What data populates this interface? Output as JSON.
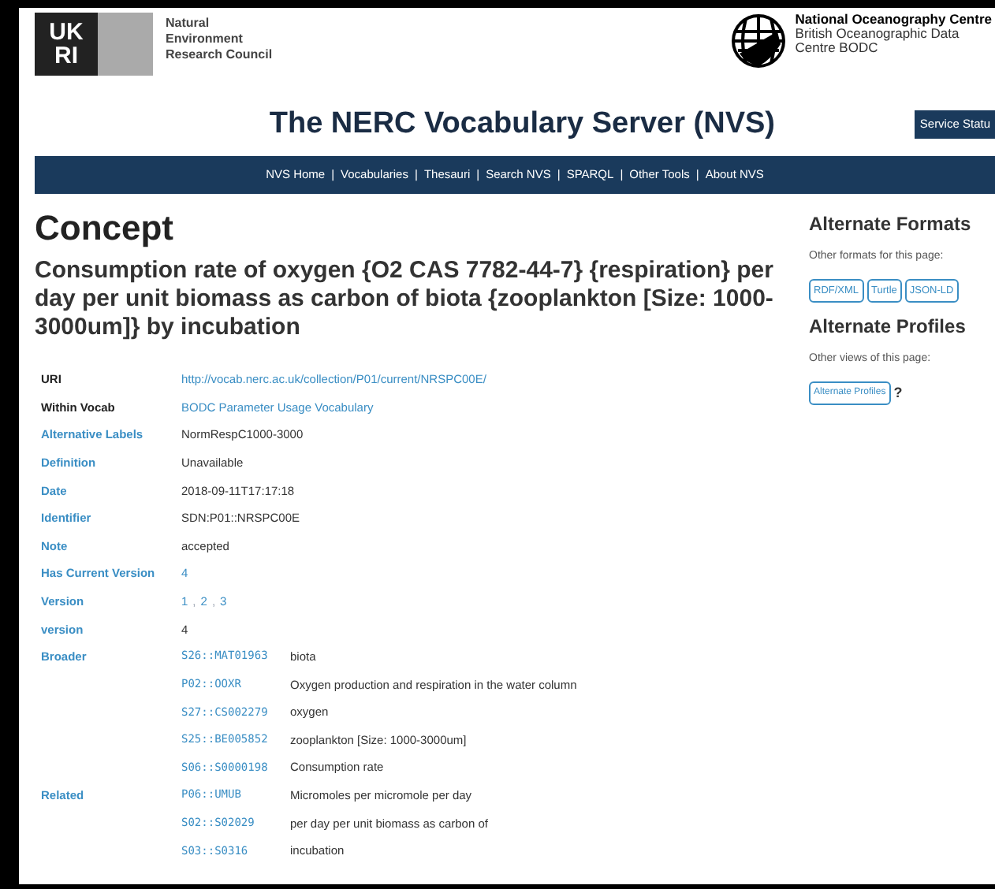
{
  "header": {
    "ukri_logo": [
      "UK",
      "RI"
    ],
    "nerc_name": [
      "Natural",
      "Environment",
      "Research Council"
    ],
    "noc_name": "National Oceanography Centre",
    "bodc_name": [
      "British Oceanographic Data",
      "Centre BODC"
    ]
  },
  "site_title": "The NERC Vocabulary Server (NVS)",
  "service_status": "Service Statu",
  "nav_separator": "|",
  "version_separator": ",",
  "nav": [
    "NVS Home",
    "Vocabularies",
    "Thesauri",
    "Search NVS",
    "SPARQL",
    "Other Tools",
    "About NVS"
  ],
  "heading": "Concept",
  "pref_label": "Consumption rate of oxygen {O2 CAS 7782-44-7} {respiration} per day per unit biomass as carbon of biota {zooplankton [Size: 1000-3000um]} by incubation",
  "properties": [
    {
      "label": "URI",
      "label_link": false,
      "kind": "link",
      "values": [
        "http://vocab.nerc.ac.uk/collection/P01/current/NRSPC00E/"
      ]
    },
    {
      "label": "Within Vocab",
      "label_link": false,
      "kind": "link",
      "values": [
        "BODC Parameter Usage Vocabulary"
      ]
    },
    {
      "label": "Alternative Labels",
      "label_link": true,
      "kind": "text",
      "values": [
        "NormRespC1000-3000"
      ]
    },
    {
      "label": "Definition",
      "label_link": true,
      "kind": "text",
      "values": [
        "Unavailable"
      ]
    },
    {
      "label": "Date",
      "label_link": true,
      "kind": "text",
      "values": [
        "2018-09-11T17:17:18"
      ]
    },
    {
      "label": "Identifier",
      "label_link": true,
      "kind": "text",
      "values": [
        "SDN:P01::NRSPC00E"
      ]
    },
    {
      "label": "Note",
      "label_link": true,
      "kind": "text",
      "values": [
        "accepted"
      ]
    },
    {
      "label": "Has Current Version",
      "label_link": true,
      "kind": "link",
      "values": [
        "4"
      ]
    },
    {
      "label": "Version",
      "label_link": true,
      "kind": "links",
      "values": [
        "1",
        "2",
        "3"
      ]
    },
    {
      "label": "version",
      "label_link": true,
      "kind": "text",
      "values": [
        "4"
      ]
    },
    {
      "label": "Broader",
      "label_link": true,
      "kind": "concepts",
      "entries": [
        {
          "code": "S26::MAT01963",
          "text": "biota"
        },
        {
          "code": "P02::OOXR",
          "text": "Oxygen production and respiration in the water column"
        },
        {
          "code": "S27::CS002279",
          "text": "oxygen"
        },
        {
          "code": "S25::BE005852",
          "text": "zooplankton [Size: 1000-3000um]"
        },
        {
          "code": "S06::S0000198",
          "text": "Consumption rate"
        }
      ]
    },
    {
      "label": "Related",
      "label_link": true,
      "kind": "concepts",
      "entries": [
        {
          "code": "P06::UMUB",
          "text": "Micromoles per micromole per day"
        },
        {
          "code": "S02::S02029",
          "text": "per day per unit biomass as carbon of"
        },
        {
          "code": "S03::S0316",
          "text": "incubation"
        }
      ]
    }
  ],
  "sidebar": {
    "formats_title": "Alternate Formats",
    "formats_note": "Other formats for this page:",
    "formats": [
      "RDF/XML",
      "Turtle",
      "JSON-LD"
    ],
    "profiles_title": "Alternate Profiles",
    "profiles_note": "Other views of this page:",
    "profiles_button": "Alternate Profiles",
    "help": "?"
  }
}
